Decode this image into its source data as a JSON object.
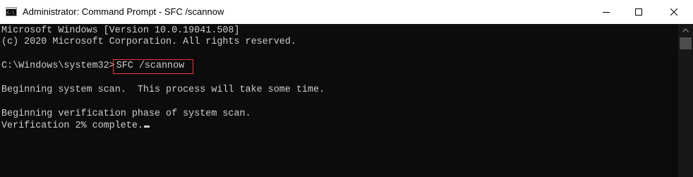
{
  "window": {
    "title": "Administrator: Command Prompt - SFC  /scannow",
    "icon": "cmd-app-icon",
    "controls": {
      "minimize": "minimize-icon",
      "maximize": "maximize-icon",
      "close": "close-icon"
    }
  },
  "console": {
    "header_line1": "Microsoft Windows [Version 10.0.19041.508]",
    "header_line2": "(c) 2020 Microsoft Corporation. All rights reserved.",
    "prompt": "C:\\Windows\\system32>",
    "command": "SFC /scannow",
    "output_line1": "Beginning system scan.  This process will take some time.",
    "output_line2": "Beginning verification phase of system scan.",
    "output_line3": "Verification 2% complete.",
    "text_color": "#cccccc",
    "background_color": "#0c0c0c",
    "highlight_color": "#e53935"
  }
}
